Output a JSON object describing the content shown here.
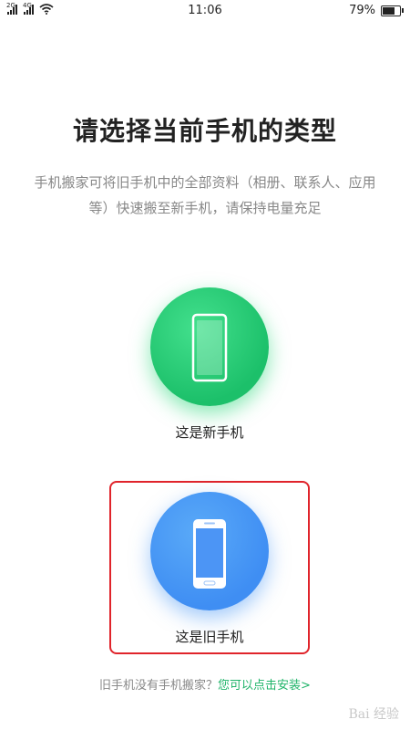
{
  "status_bar": {
    "time": "11:06",
    "battery": "79%",
    "battery_level": 0.79,
    "signal_1": "2G",
    "signal_2": "4G",
    "icons": [
      "signal-icon",
      "signal-icon",
      "wifi-icon",
      "battery-icon"
    ]
  },
  "page": {
    "title": "请选择当前手机的类型",
    "subtitle": "手机搬家可将旧手机中的全部资料（相册、联系人、应用等）快速搬至新手机，请保持电量充足"
  },
  "options": {
    "new_phone": {
      "label": "这是新手机",
      "color": "#1cc06a"
    },
    "old_phone": {
      "label": "这是旧手机",
      "color": "#3f8ef3",
      "highlight": "#e0242b"
    }
  },
  "footer": {
    "text": "旧手机没有手机搬家？",
    "link": "您可以点击安装>"
  },
  "watermark": "Bai 经验"
}
